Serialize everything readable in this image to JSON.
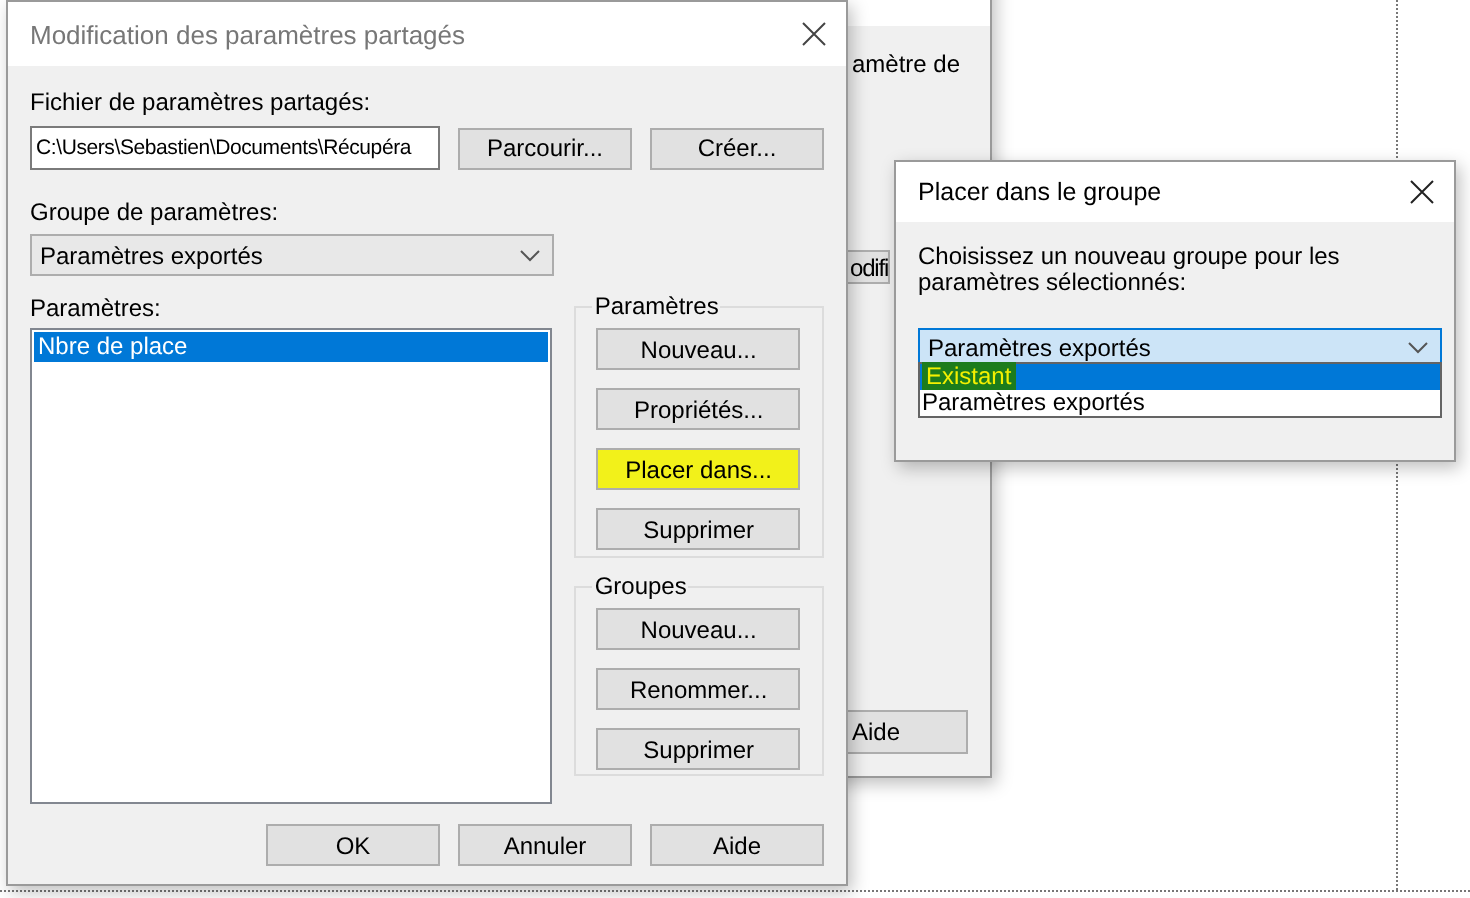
{
  "back_dialog": {
    "label_fragment": "amètre de",
    "button_fragment": "odifi",
    "help_button": "Aide"
  },
  "main_dialog": {
    "title": "Modification des paramètres partagés",
    "file_label": "Fichier de paramètres partagés:",
    "file_path": "C:\\Users\\Sebastien\\Documents\\Récupéra",
    "browse_button": "Parcourir...",
    "create_button": "Créer...",
    "group_label": "Groupe de paramètres:",
    "group_value": "Paramètres exportés",
    "params_label": "Paramètres:",
    "params": [
      {
        "label": "Nbre de place",
        "selected": true
      }
    ],
    "param_box": {
      "title": "Paramètres",
      "buttons": [
        {
          "label": "Nouveau...",
          "highlighted": false
        },
        {
          "label": "Propriétés...",
          "highlighted": false
        },
        {
          "label": "Placer dans...",
          "highlighted": true
        },
        {
          "label": "Supprimer",
          "highlighted": false
        }
      ]
    },
    "group_box": {
      "title": "Groupes",
      "buttons": [
        {
          "label": "Nouveau...",
          "highlighted": false
        },
        {
          "label": "Renommer...",
          "highlighted": false
        },
        {
          "label": "Supprimer",
          "highlighted": false
        }
      ]
    },
    "footer_buttons": [
      "OK",
      "Annuler",
      "Aide"
    ]
  },
  "move_dialog": {
    "title": "Placer dans le groupe",
    "prompt": "Choisissez un nouveau groupe pour les paramètres sélectionnés:",
    "combo_value": "Paramètres exportés",
    "options": [
      {
        "label": "Existant",
        "selected": true,
        "highlighted": true
      },
      {
        "label": "Paramètres exportés",
        "selected": false,
        "highlighted": false
      }
    ]
  }
}
